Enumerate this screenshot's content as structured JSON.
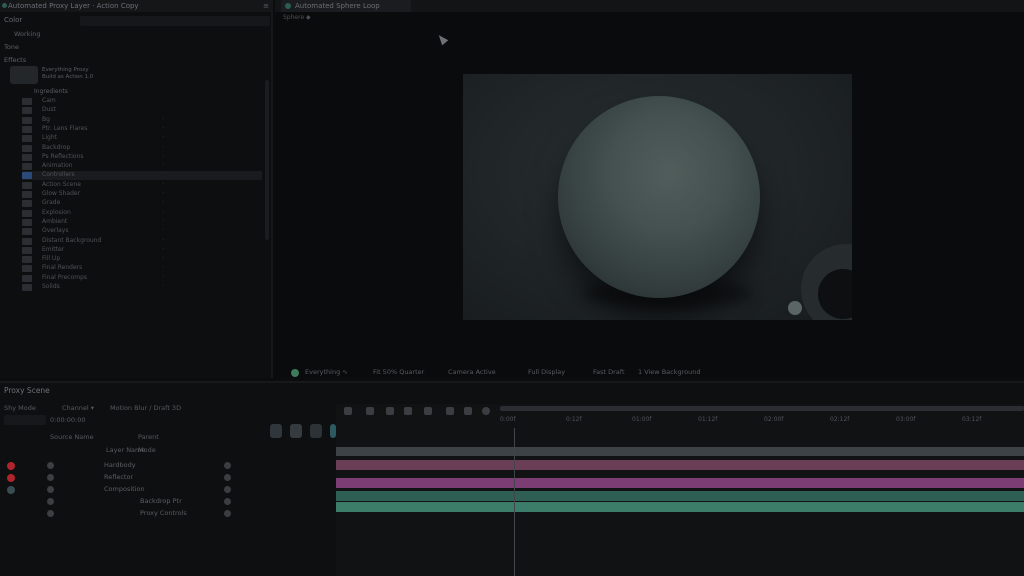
{
  "project": {
    "tab_title": "Automated Proxy Layer · Action Copy",
    "tab_menu": "≡",
    "rows": [
      "Color",
      "Working",
      "Tone",
      "Effects"
    ],
    "search_placeholder": "",
    "thumb_caption": "Everything Proxy\nBuild as Action 1.0",
    "folder_label": "Ingredients",
    "items": [
      {
        "label": "Cam",
        "col": ""
      },
      {
        "label": "Dust",
        "col": ""
      },
      {
        "label": "Bg",
        "col": "·"
      },
      {
        "label": "Ptr. Lens Flares",
        "col": "·"
      },
      {
        "label": "Light",
        "col": "·"
      },
      {
        "label": "Backdrop",
        "col": "·"
      },
      {
        "label": "Ps Reflections",
        "col": "·"
      },
      {
        "label": "Animation",
        "col": "·"
      },
      {
        "label": "Controllers",
        "col": "·"
      },
      {
        "label": "Action Scene",
        "col": "·"
      },
      {
        "label": "Glow Shader",
        "col": "·"
      },
      {
        "label": "Grade",
        "col": "·"
      },
      {
        "label": "Explosion",
        "col": "·"
      },
      {
        "label": "Ambient",
        "col": "·"
      },
      {
        "label": "Overlays",
        "col": "·"
      },
      {
        "label": "Distant Background",
        "col": "·"
      },
      {
        "label": "Emitter",
        "col": "·"
      },
      {
        "label": "Fill Up",
        "col": "·"
      },
      {
        "label": "Final Renders",
        "col": "·"
      },
      {
        "label": "Final Precomps",
        "col": "·"
      },
      {
        "label": "Solids",
        "col": "·"
      }
    ]
  },
  "viewer": {
    "tab_title": "Automated Sphere Loop",
    "sub_label": "Sphere ◆",
    "footer": [
      "Everything ∿",
      "Fit 50% Quarter",
      "Camera Active",
      "Full Display",
      "Fast Draft",
      "1 View Background"
    ]
  },
  "timeline": {
    "tab_title": "Proxy Scene",
    "timecode": "0:00:00:00",
    "controls": [
      "Shy Mode",
      "Channel ▾",
      "Motion Blur / Draft 3D"
    ],
    "search": "",
    "col_headers": [
      "Layer Name",
      "Parent"
    ],
    "col_headers2": [
      "#",
      "Source Name",
      "Mode"
    ],
    "layers": [
      {
        "name": "Hardbody",
        "color": "#b0242b"
      },
      {
        "name": "Reflector",
        "color": "#b0242b"
      },
      {
        "name": "Composition",
        "color": "#3a4c52"
      },
      {
        "name": "Backdrop Ptr",
        "color": ""
      },
      {
        "name": "Proxy Controls",
        "color": ""
      }
    ],
    "ruler_ticks": [
      "0:00f",
      "0:12f",
      "01:00f",
      "01:12f",
      "02:00f",
      "02:12f",
      "03:00f",
      "03:12f"
    ],
    "tracks": [
      {
        "color": "#3d4247"
      },
      {
        "color": "#6a3e56"
      },
      {
        "color": "#7b3d74"
      },
      {
        "color": "#2f5e55"
      },
      {
        "color": "#3c7d6a"
      }
    ]
  },
  "colors": {
    "accent_green": "#3d7b5c",
    "label_red": "#b0242b",
    "track_magenta": "#7b3d74",
    "track_teal": "#3c7d6a"
  }
}
